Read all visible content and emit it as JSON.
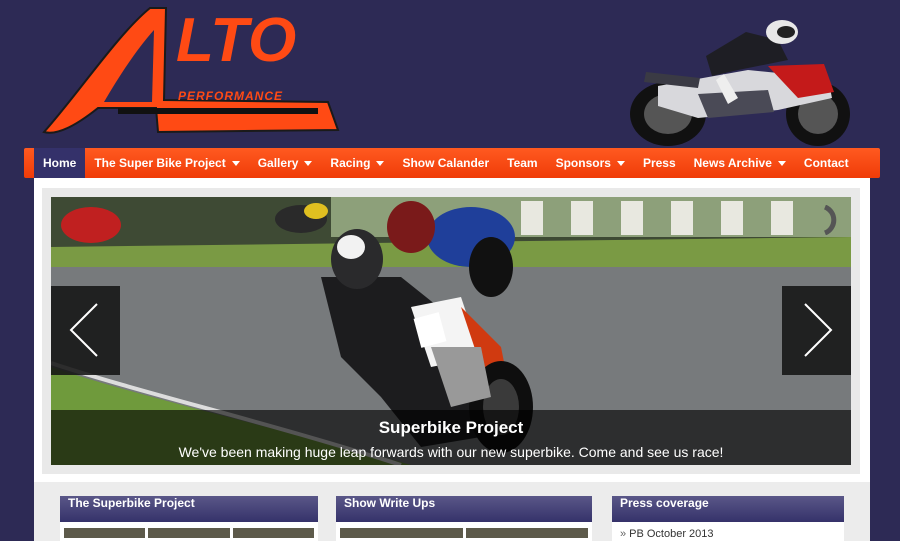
{
  "logo": {
    "word": "LTO",
    "sub": "PERFORMANCE"
  },
  "nav": {
    "items": [
      {
        "label": "Home",
        "active": true,
        "dropdown": false
      },
      {
        "label": "The Super Bike Project",
        "dropdown": true
      },
      {
        "label": "Gallery",
        "dropdown": true
      },
      {
        "label": "Racing",
        "dropdown": true
      },
      {
        "label": "Show Calander",
        "dropdown": false
      },
      {
        "label": "Team",
        "dropdown": false
      },
      {
        "label": "Sponsors",
        "dropdown": true
      },
      {
        "label": "Press",
        "dropdown": false
      },
      {
        "label": "News Archive",
        "dropdown": true
      },
      {
        "label": "Contact",
        "dropdown": false
      }
    ]
  },
  "slider": {
    "title": "Superbike Project",
    "description": "We've been making huge leap forwards with our new superbike. Come and see us race!"
  },
  "widgets": [
    {
      "title": "The Superbike Project"
    },
    {
      "title": "Show Write Ups"
    },
    {
      "title": "Press coverage",
      "first_item": "PB October 2013"
    }
  ],
  "colors": {
    "background": "#2d2a55",
    "accent": "#ff4a14",
    "nav_active": "#34316a"
  }
}
